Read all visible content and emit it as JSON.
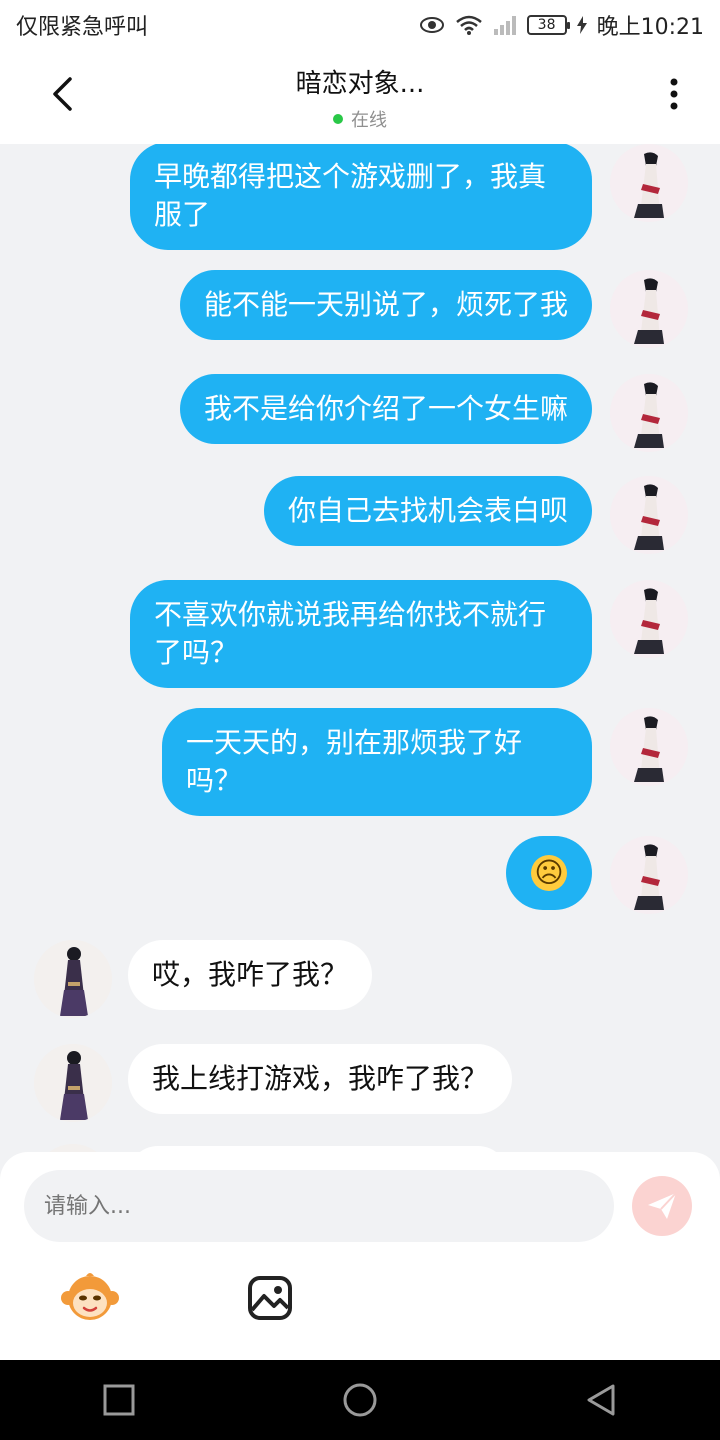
{
  "status_bar": {
    "left_text": "仅限紧急呼叫",
    "battery": "38",
    "time": "晚上10:21"
  },
  "header": {
    "title": "暗恋对象...",
    "status": "在线",
    "online_color": "#29c847"
  },
  "messages": [
    {
      "side": "sent",
      "text": "早晚都得把这个游戏删了，我真服了"
    },
    {
      "side": "sent",
      "text": "能不能一天别说了，烦死了我"
    },
    {
      "side": "sent",
      "text": "我不是给你介绍了一个女生嘛"
    },
    {
      "side": "sent",
      "text": "你自己去找机会表白呗"
    },
    {
      "side": "sent",
      "text": "不喜欢你就说我再给你找不就行了吗？"
    },
    {
      "side": "sent",
      "text": "一天天的，别在那烦我了好吗？"
    },
    {
      "side": "sent",
      "text": "☹"
    },
    {
      "side": "received",
      "text": "哎，我咋了我？"
    },
    {
      "side": "received",
      "text": "我上线打游戏，我咋了我？"
    }
  ],
  "composer": {
    "placeholder": "请输入..."
  },
  "colors": {
    "sent_bubble": "#1fb2f3",
    "received_bubble": "#ffffff",
    "background": "#f1f2f4",
    "send_button": "#fbd3d1"
  },
  "icons": {
    "back": "chevron-left-icon",
    "more": "more-vertical-icon",
    "send": "paper-plane-icon",
    "sticker": "monkey-face-icon",
    "image": "image-icon",
    "nav_recent": "square-icon",
    "nav_home": "circle-icon",
    "nav_back": "triangle-back-icon"
  }
}
